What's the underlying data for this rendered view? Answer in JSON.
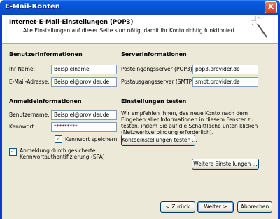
{
  "window": {
    "title": "E-Mail-Konten",
    "close_label": "X"
  },
  "header": {
    "title": "Internet-E-Mail-Einstellungen (POP3)",
    "subtitle": "Alle Einstellungen auf dieser Seite sind nötig, damit Ihr Konto richtig funktioniert."
  },
  "user_info": {
    "heading": "Benutzerinformationen",
    "name_label": "Ihr Name:",
    "name_value": "Beispielname",
    "email_label": "E-Mail-Adresse:",
    "email_value": "Beispiel@provider.de"
  },
  "server_info": {
    "heading": "Serverinformationen",
    "incoming_label": "Posteingangsserver (POP3):",
    "incoming_value": "pop3.provider.de",
    "outgoing_label": "Postausgangsserver (SMTP):",
    "outgoing_value": "smpt.provider.de"
  },
  "login_info": {
    "heading": "Anmeldeinformationen",
    "username_label": "Benutzername:",
    "username_value": "Beispiel@provider.de",
    "password_label": "Kennwort:",
    "password_value": "*********",
    "save_password_label": "Kennwort speichern",
    "save_password_checked": true,
    "spa_label_line1": "Anmeldung durch gesicherte",
    "spa_label_line2": "Kennwortauthentifizierung (SPA)",
    "spa_checked": true
  },
  "test_settings": {
    "heading": "Einstellungen testen",
    "description_lines": [
      "Wir empfehlen Ihnen, das neue Konto nach dem",
      "Eingeben aller Informationen in diesem Fenster zu",
      "testen, indem Sie auf die Schaltfläche unten klicken",
      "(Netzwerkverbindung erforderlich)."
    ],
    "test_button": "Kontoeinstellungen testen ..."
  },
  "more_settings_button": "Weitere Einstellungen ...",
  "footer": {
    "back_button": "< Zurück",
    "next_button": "Weiter >",
    "cancel_button": "Abbrechen"
  },
  "colors": {
    "titlebar": "#0753d6",
    "dialog_bg": "#ece9d8",
    "check_mark": "#21a121"
  }
}
